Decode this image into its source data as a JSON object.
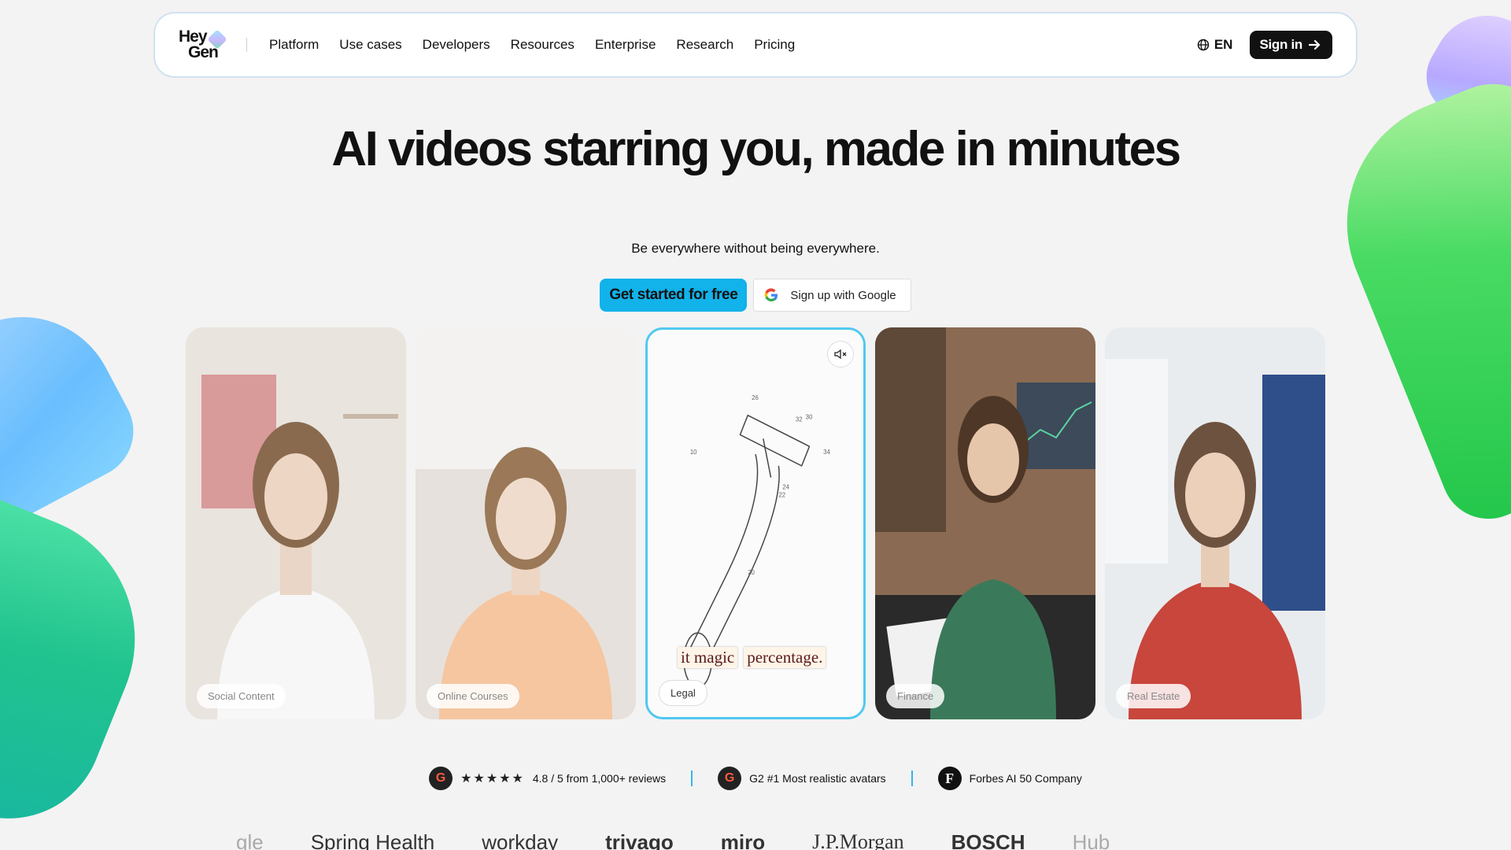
{
  "nav": {
    "logo_line1": "Hey",
    "logo_line2": "Gen",
    "links": [
      "Platform",
      "Use cases",
      "Developers",
      "Resources",
      "Enterprise",
      "Research",
      "Pricing"
    ],
    "lang": "EN",
    "signin": "Sign in"
  },
  "hero": {
    "title": "AI videos starring you, made in minutes",
    "subtitle": "Be everywhere without being everywhere.",
    "cta_primary": "Get started for free",
    "cta_google": "Sign up with Google"
  },
  "cards": [
    {
      "label": "Social Content"
    },
    {
      "label": "Online Courses"
    },
    {
      "label": "Legal",
      "caption": [
        "it magic",
        "percentage."
      ]
    },
    {
      "label": "Finance"
    },
    {
      "label": "Real Estate"
    }
  ],
  "badges": {
    "rating": "4.8 / 5 from 1,000+ reviews",
    "g2": "G2 #1 Most realistic avatars",
    "forbes": "Forbes AI 50 Company",
    "g2_icon_letter": "G",
    "forbes_icon_letter": "F"
  },
  "logos": [
    "gle",
    "Spring Health",
    "workday",
    "trivago",
    "miro",
    "J.P.Morgan",
    "BOSCH",
    "Hub"
  ],
  "colors": {
    "accent": "#12b2ea",
    "dark": "#111111",
    "page_bg": "#f3f3f3"
  }
}
